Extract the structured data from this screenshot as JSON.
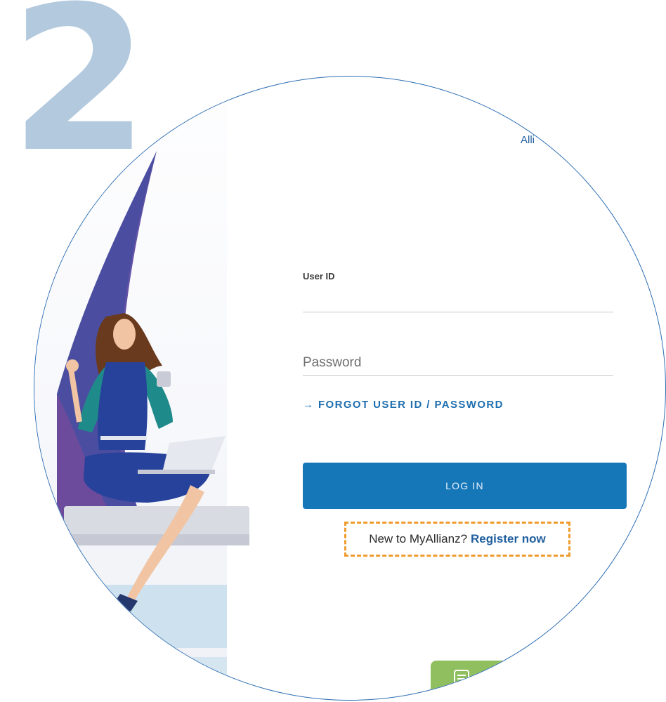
{
  "step_number": "2",
  "brand_partial": "Alli",
  "login_form": {
    "userid_label": "User ID",
    "password_placeholder": "Password",
    "forgot_link": "→ FORGOT USER ID / PASSWORD",
    "login_button": "LOG IN",
    "register_prompt": "New to MyAllianz?",
    "register_link": "Register now"
  },
  "colors": {
    "step_number": "#b3c9de",
    "primary": "#1677b8",
    "highlight_border": "#ef9b2e",
    "chat_tab": "#8fbf5f"
  },
  "icons": {
    "forgot_arrow": "arrow-right-icon",
    "chat": "chat-icon"
  }
}
